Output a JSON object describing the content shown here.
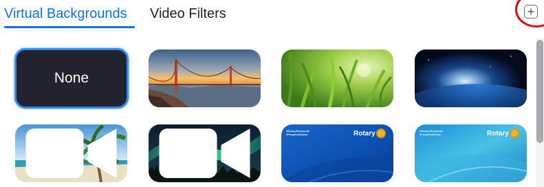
{
  "tabs": {
    "virtual_backgrounds": "Virtual Backgrounds",
    "video_filters": "Video Filters",
    "active": "virtual_backgrounds"
  },
  "add_button": {
    "label": "+",
    "icon": "plus-square-icon"
  },
  "backgrounds": {
    "none_label": "None",
    "items": [
      {
        "name": "golden-gate-bridge",
        "selected": false
      },
      {
        "name": "grass",
        "selected": false
      },
      {
        "name": "earth-from-space",
        "selected": false
      },
      {
        "name": "beach-palm",
        "selected": false,
        "video": true
      },
      {
        "name": "aurora",
        "selected": false,
        "video": true
      },
      {
        "name": "rotary-blue",
        "selected": false
      },
      {
        "name": "rotary-teal",
        "selected": false
      }
    ]
  },
  "rotary": {
    "tagline_1": "#RotaryResponds",
    "tagline_2": "#PeopleofAction",
    "brand": "Rotary"
  },
  "colors": {
    "accent": "#0e72ed",
    "selection_border": "#2d8cff",
    "highlight_circle": "#e60012",
    "none_bg": "#22232e"
  }
}
